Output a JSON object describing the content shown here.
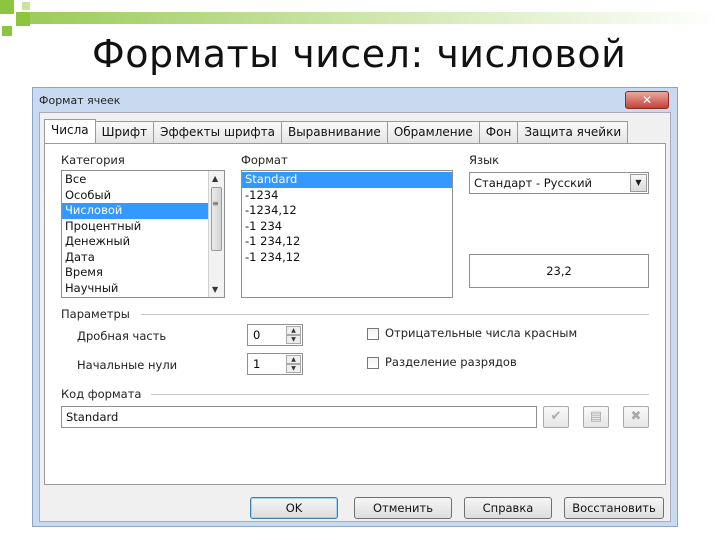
{
  "slide": {
    "title": "Форматы чисел: числовой"
  },
  "dialog": {
    "title": "Формат ячеек",
    "close_glyph": "✕",
    "tabs": [
      {
        "label": "Числа",
        "active": true
      },
      {
        "label": "Шрифт",
        "active": false
      },
      {
        "label": "Эффекты шрифта",
        "active": false
      },
      {
        "label": "Выравнивание",
        "active": false
      },
      {
        "label": "Обрамление",
        "active": false
      },
      {
        "label": "Фон",
        "active": false
      },
      {
        "label": "Защита ячейки",
        "active": false
      }
    ],
    "category": {
      "label": "Категория",
      "items": [
        "Все",
        "Особый",
        "Числовой",
        "Процентный",
        "Денежный",
        "Дата",
        "Время",
        "Научный"
      ],
      "selected_index": 2
    },
    "format": {
      "label": "Формат",
      "items": [
        "Standard",
        "-1234",
        "-1234,12",
        "-1 234",
        "-1 234,12",
        "-1 234,12"
      ],
      "selected_index": 0
    },
    "language": {
      "label": "Язык",
      "value": "Стандарт - Русский"
    },
    "preview": {
      "value": "23,2"
    },
    "options": {
      "label": "Параметры",
      "decimal_places_label": "Дробная часть",
      "decimal_places_value": "0",
      "leading_zeros_label": "Начальные нули",
      "leading_zeros_value": "1",
      "negative_red_label": "Отрицательные числа красным",
      "negative_red_checked": false,
      "thousands_sep_label": "Разделение разрядов",
      "thousands_sep_checked": false
    },
    "format_code": {
      "label": "Код формата",
      "value": "Standard"
    },
    "icons": {
      "accept": "check-icon",
      "comment": "comment-icon",
      "delete": "delete-icon"
    },
    "buttons": {
      "ok": "OK",
      "cancel": "Отменить",
      "help": "Справка",
      "reset": "Восстановить"
    }
  }
}
